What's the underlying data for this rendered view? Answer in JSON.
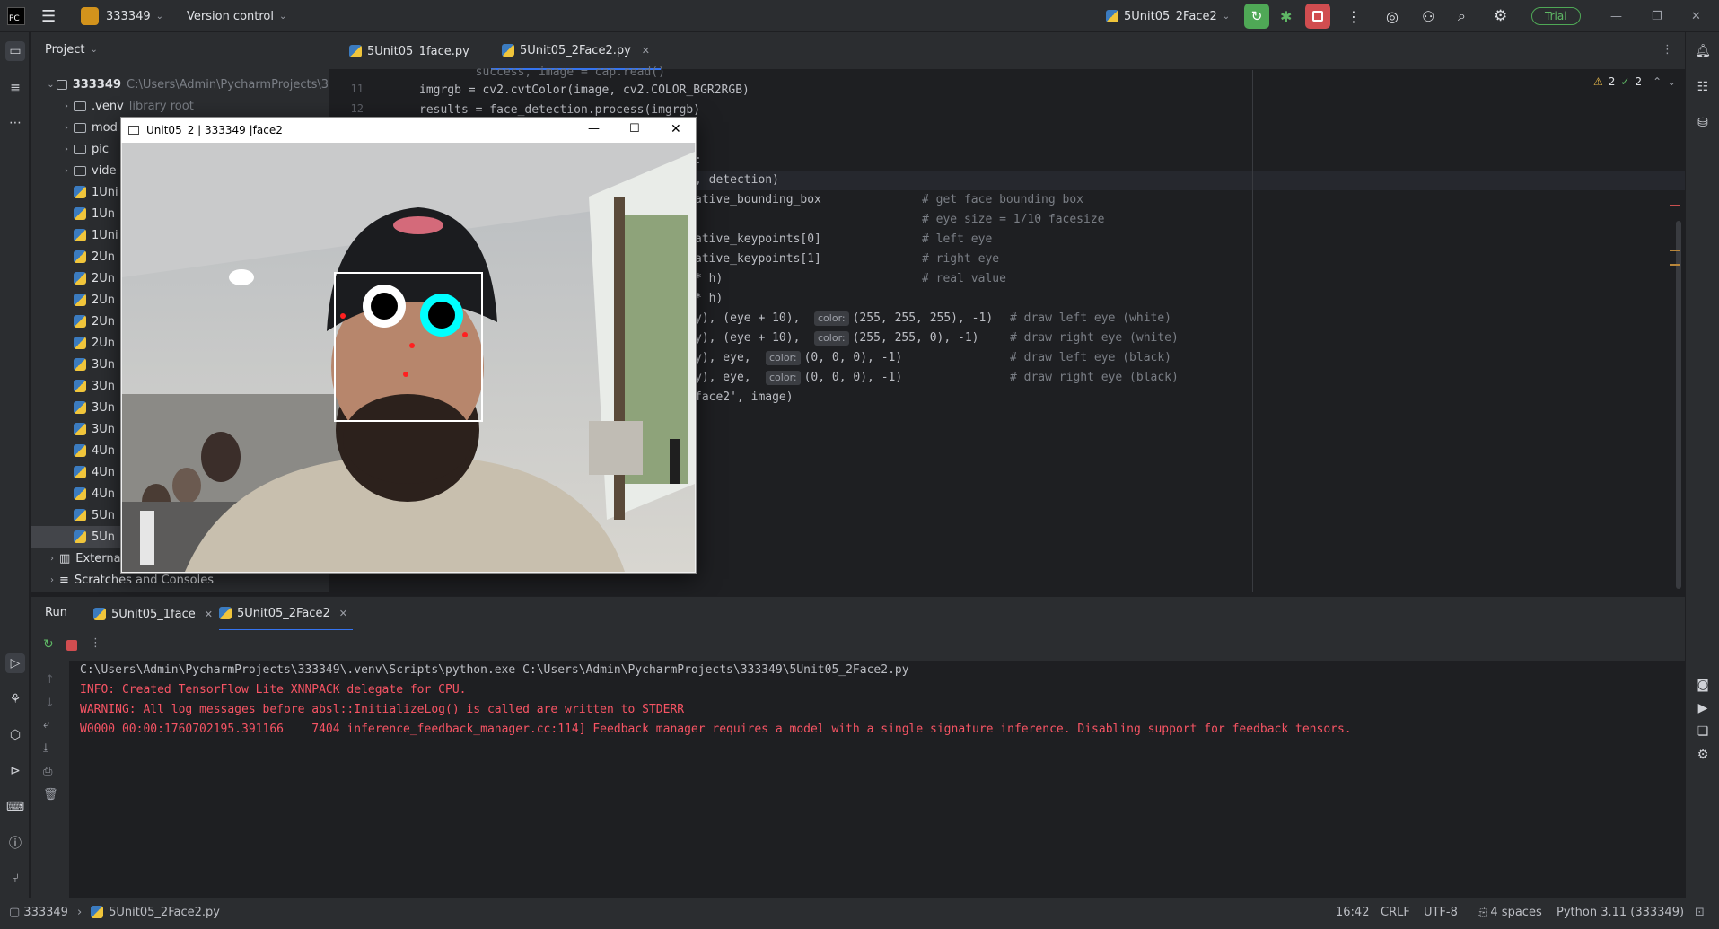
{
  "titlebar": {
    "project_name": "333349",
    "version_control": "Version control",
    "run_config": "5Unit05_2Face2",
    "trial_label": "Trial"
  },
  "project_panel": {
    "header": "Project",
    "root_name": "333349",
    "root_path": "C:\\Users\\Admin\\PycharmProjects\\3",
    "items": [
      {
        "label": ".venv",
        "note": "library root",
        "kind": "folder"
      },
      {
        "label": "mod",
        "kind": "folder"
      },
      {
        "label": "pic",
        "kind": "folder"
      },
      {
        "label": "vide",
        "kind": "folder"
      },
      {
        "label": "1Uni",
        "kind": "py"
      },
      {
        "label": "1Un",
        "kind": "py"
      },
      {
        "label": "1Uni",
        "kind": "py"
      },
      {
        "label": "2Un",
        "kind": "py"
      },
      {
        "label": "2Un",
        "kind": "py"
      },
      {
        "label": "2Un",
        "kind": "py"
      },
      {
        "label": "2Un",
        "kind": "py"
      },
      {
        "label": "2Un",
        "kind": "py"
      },
      {
        "label": "3Un",
        "kind": "py"
      },
      {
        "label": "3Un",
        "kind": "py"
      },
      {
        "label": "3Un",
        "kind": "py"
      },
      {
        "label": "3Un",
        "kind": "py"
      },
      {
        "label": "4Un",
        "kind": "py"
      },
      {
        "label": "4Un",
        "kind": "py"
      },
      {
        "label": "4Un",
        "kind": "py"
      },
      {
        "label": "5Un",
        "kind": "py"
      },
      {
        "label": "5Un",
        "kind": "py"
      }
    ],
    "external": "Externa",
    "scratches": "Scratches and Consoles"
  },
  "editor": {
    "tabs": [
      "5Unit05_1face.py",
      "5Unit05_2Face2.py"
    ],
    "inspection": {
      "warnings": "2",
      "checks": "2"
    },
    "line_numbers": [
      "11",
      "12"
    ],
    "lines": {
      "l0": "        success, image = cap.read()",
      "l1": "imgrgb = cv2.cvtColor(image, cv2.COLOR_BGR2RGB)",
      "l2": "results = face_detection.process(imgrgb)",
      "l3": ":",
      "l4": ", detection)",
      "l5a": "ative_bounding_box",
      "l5c": "# get face bounding box",
      "l6c": "# eye size = 1/10 facesize",
      "l7a": "ative_keypoints[0]",
      "l7c": "# left eye",
      "l8a": "ative_keypoints[1]",
      "l8c": "# right eye",
      "l9a": "* h)",
      "l9c": "# real value",
      "l10a": "* h)",
      "l11a": "y), (eye + 10),",
      "l11b": "(255, 255, 255), -1)",
      "l11c": "# draw left eye (white)",
      "l12a": "y), (eye + 10),",
      "l12b": "(255, 255, 0), -1)",
      "l12c": "# draw right eye (white)",
      "l13a": "y), eye,",
      "l13b": "(0, 0, 0), -1)",
      "l13c": "# draw left eye (black)",
      "l14a": "y), eye,",
      "l14b": "(0, 0, 0), -1)",
      "l14c": "# draw right eye (black)",
      "l15": "face2', image)",
      "hint": "color:"
    }
  },
  "cv_window": {
    "title": "Unit05_2 | 333349 |face2"
  },
  "run_panel": {
    "run_label": "Run",
    "tabs": [
      "5Unit05_1face",
      "5Unit05_2Face2"
    ],
    "console": [
      {
        "text": "C:\\Users\\Admin\\PycharmProjects\\333349\\.venv\\Scripts\\python.exe C:\\Users\\Admin\\PycharmProjects\\333349\\5Unit05_2Face2.py",
        "color": "#bcbec4"
      },
      {
        "text": "INFO: Created TensorFlow Lite XNNPACK delegate for CPU.",
        "color": "#f75464"
      },
      {
        "text": "WARNING: All log messages before absl::InitializeLog() is called are written to STDERR",
        "color": "#f75464"
      },
      {
        "text": "W0000 00:00:1760702195.391166    7404 inference_feedback_manager.cc:114] Feedback manager requires a model with a single signature inference. Disabling support for feedback tensors.",
        "color": "#f75464"
      }
    ]
  },
  "statusbar": {
    "project": "333349",
    "file": "5Unit05_2Face2.py",
    "position": "16:42",
    "line_ending": "CRLF",
    "encoding": "UTF-8",
    "indent": "4 spaces",
    "interpreter": "Python 3.11 (333349)"
  },
  "colors": {
    "accent": "#3574f0",
    "error": "#f75464",
    "run_green": "#4fa856",
    "stop_red": "#d14d50"
  }
}
